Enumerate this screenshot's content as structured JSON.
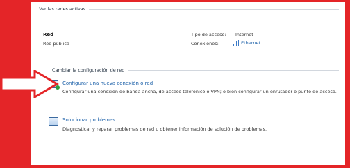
{
  "active_networks": {
    "section_title": "Ver las redes activas",
    "network_name": "Red",
    "network_category": "Red pública",
    "access_type_label": "Tipo de acceso:",
    "access_type_value": "Internet",
    "connections_label": "Conexiones:",
    "connections_value": "Ethernet"
  },
  "change_settings": {
    "section_title": "Cambiar la configuración de red",
    "tasks": [
      {
        "title": "Configurar una nueva conexión o red",
        "description": "Configurar una conexión de banda ancha, de acceso telefónico o VPN; o bien configurar un enrutador o punto de acceso."
      },
      {
        "title": "Solucionar problemas",
        "description": "Diagnosticar y reparar problemas de red u obtener información de solución de problemas."
      }
    ]
  },
  "colors": {
    "frame": "#e42528",
    "link": "#1a5fa8"
  }
}
